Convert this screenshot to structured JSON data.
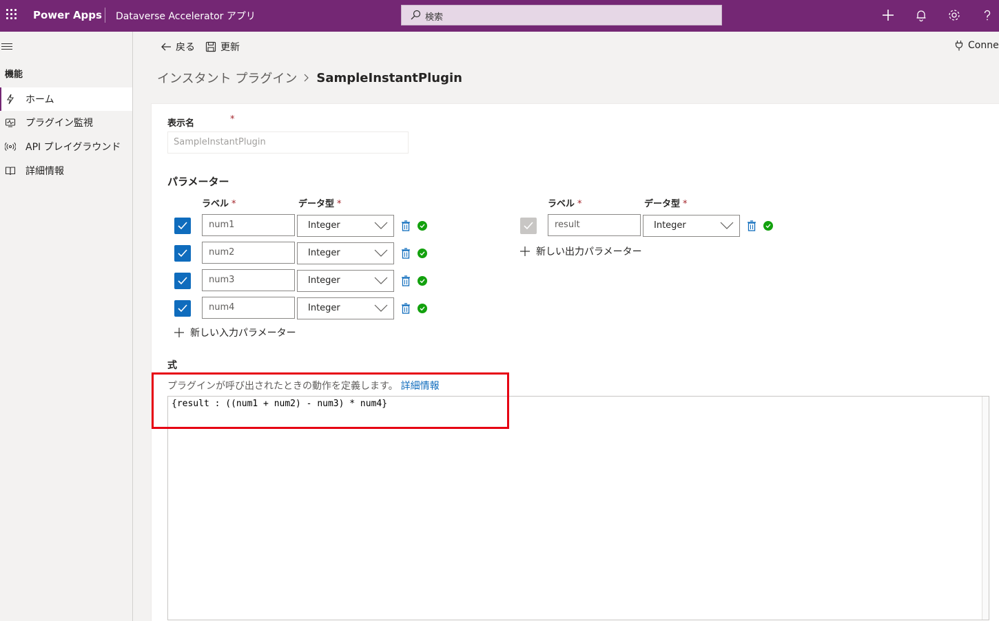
{
  "topbar": {
    "app_name": "Power Apps",
    "environment": "Dataverse Accelerator アプリ",
    "search_placeholder": "検索",
    "brand_color": "#742774"
  },
  "commandbar": {
    "back_label": "戻る",
    "save_label": "更新",
    "connect_label": "Connec"
  },
  "sidebar": {
    "heading": "機能",
    "items": [
      {
        "label": "ホーム",
        "icon": "plugin-icon",
        "active": true
      },
      {
        "label": "プラグイン監視",
        "icon": "monitor-icon",
        "active": false
      },
      {
        "label": "API プレイグラウンド",
        "icon": "broadcast-icon",
        "active": false
      },
      {
        "label": "詳細情報",
        "icon": "book-icon",
        "active": false
      }
    ]
  },
  "breadcrumb": {
    "root": "インスタント プラグイン",
    "current": "SampleInstantPlugin"
  },
  "form": {
    "display_name_label": "表示名",
    "display_name_required": "*",
    "display_name_value": "SampleInstantPlugin",
    "parameters_title": "パラメーター",
    "input_params": {
      "label_header": "ラベル",
      "type_header": "データ型",
      "required_mark": "*",
      "rows": [
        {
          "label": "num1",
          "type": "Integer"
        },
        {
          "label": "num2",
          "type": "Integer"
        },
        {
          "label": "num3",
          "type": "Integer"
        },
        {
          "label": "num4",
          "type": "Integer"
        }
      ],
      "add_label": "新しい入力パラメーター"
    },
    "output_params": {
      "label_header": "ラベル",
      "type_header": "データ型",
      "required_mark": "*",
      "rows": [
        {
          "label": "result",
          "type": "Integer"
        }
      ],
      "add_label": "新しい出力パラメーター"
    },
    "formula_label": "式",
    "formula_description": "プラグインが呼び出されたときの動作を定義します。",
    "formula_learn_more": "詳細情報",
    "formula_code": "{result : ((num1 + num2) - num3) * num4}"
  }
}
